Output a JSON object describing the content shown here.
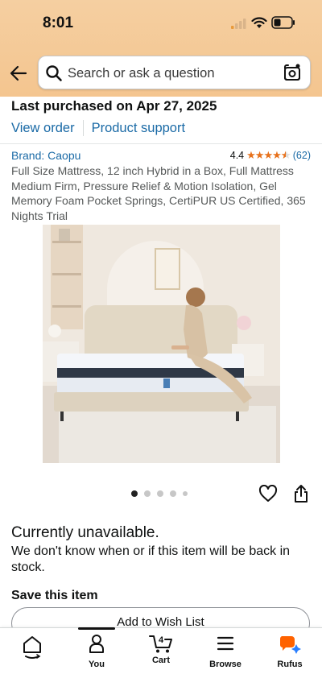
{
  "status_bar": {
    "time": "8:01"
  },
  "search": {
    "placeholder": "Search or ask a question"
  },
  "order": {
    "heading": "Last purchased on Apr 27, 2025",
    "view_order": "View order",
    "product_support": "Product support"
  },
  "product": {
    "brand": "Brand: Caopu",
    "rating_value": "4.4",
    "rating_stars": 4.4,
    "rating_count": "(62)",
    "title": "Full Size Mattress, 12 inch Hybrid in a Box, Full Mattress Medium Firm, Pressure Relief & Motion Isolation, Gel Memory Foam Pocket Springs, CertiPUR US Certified, 365 Nights Trial"
  },
  "gallery": {
    "image_count": 5,
    "active_index": 0
  },
  "availability": {
    "status": "Currently unavailable.",
    "detail": "We don't know when or if this item will be back in stock."
  },
  "save": {
    "heading": "Save this item",
    "wish_list_button": "Add to Wish List"
  },
  "tabbar": {
    "items": [
      {
        "label": "",
        "icon": "home-icon"
      },
      {
        "label": "You",
        "icon": "person-icon"
      },
      {
        "label": "Cart",
        "icon": "cart-icon",
        "count": "4"
      },
      {
        "label": "Browse",
        "icon": "menu-icon"
      },
      {
        "label": "Rufus",
        "icon": "rufus-icon"
      }
    ]
  },
  "colors": {
    "header": "#f4c58f",
    "link": "#1a6aa6",
    "star": "#e7711b",
    "rufus_orange": "#ff6200",
    "rufus_blue": "#2a7fff"
  }
}
